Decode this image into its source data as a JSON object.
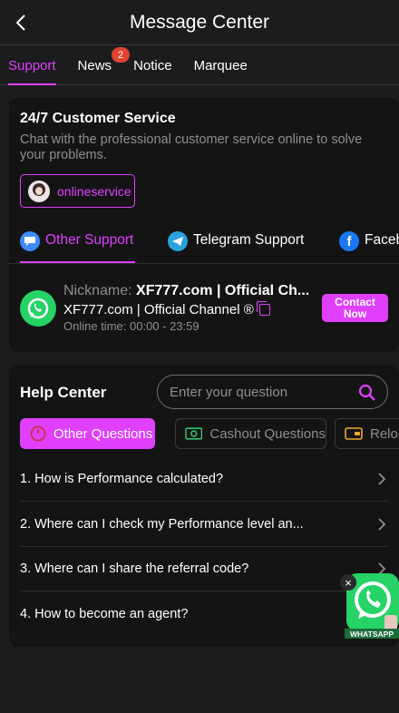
{
  "header": {
    "title": "Message Center"
  },
  "tabs": [
    {
      "label": "Support",
      "active": true
    },
    {
      "label": "News",
      "badge": "2"
    },
    {
      "label": "Notice"
    },
    {
      "label": "Marquee"
    }
  ],
  "customer_service": {
    "title": "24/7 Customer Service",
    "description": "Chat with the professional customer service online to solve your problems.",
    "online_button": "onlineservice"
  },
  "support_tabs": [
    {
      "label": "Other Support",
      "icon": "chat-bubble-icon",
      "active": true
    },
    {
      "label": "Telegram Support",
      "icon": "telegram-icon"
    },
    {
      "label": "Facebook",
      "icon": "facebook-icon"
    }
  ],
  "channel": {
    "nickname_label": "Nickname:",
    "nickname_value": "XF777.com | Official Ch...",
    "name": "XF777.com | Official Channel ®",
    "online_time_label": "Online time:",
    "online_time_value": "00:00 - 23:59",
    "contact_button": "Contact Now"
  },
  "help_center": {
    "title": "Help Center",
    "search_placeholder": "Enter your question",
    "categories": [
      {
        "label": "Other Questions",
        "icon": "question-circle-icon",
        "active": true
      },
      {
        "label": "Cashout Questions",
        "icon": "cash-icon"
      },
      {
        "label": "Reload",
        "icon": "wallet-icon"
      }
    ],
    "questions": [
      "1. How is Performance calculated?",
      "2. Where can I check my Performance level an...",
      "3. Where can I share the referral code?",
      "4. How to become an agent?"
    ]
  },
  "floating": {
    "label": "WHATSAPP",
    "close": "×"
  },
  "colors": {
    "accent": "#e040fb",
    "background": "#1c1c1e",
    "card": "#141414",
    "whatsapp": "#25d366",
    "badge": "#e0442f"
  }
}
